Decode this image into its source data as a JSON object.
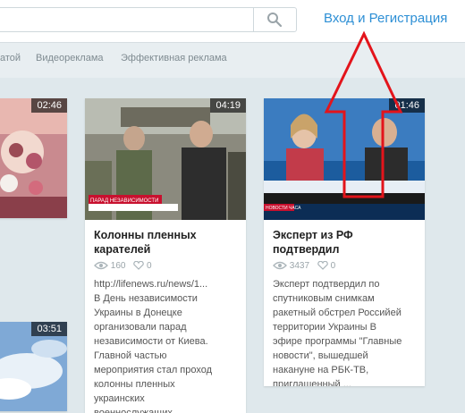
{
  "header": {
    "login_link": "Вход и Регистрация"
  },
  "nav": {
    "items": [
      "атой",
      "Видеореклама",
      "Эффективная реклама"
    ]
  },
  "cards": [
    {
      "duration": "02:46"
    },
    {
      "duration": "04:19",
      "title": "Колонны пленных\nкарателей",
      "views": "160",
      "likes": "0",
      "description": "http://lifenews.ru/news/1...\nВ День независимости\nУкраины в Донецке\nорганизовали парад\nнезависимости от Киева.\nГлавной частью\nмероприятия стал проход\nколонны пленных\nукраинских\nвоеннослужащих ...",
      "thumb_caption": "ПАРАД НЕЗАВИСИМОСТИ"
    },
    {
      "duration": "01:46",
      "title": "Эксперт из РФ\nподтвердил",
      "views": "3437",
      "likes": "0",
      "description": "Эксперт подтвердил по\nспутниковым снимкам\nракетный обстрел Российей\nтерритории Украины В\nэфире программы \"Главные\nновости\", вышедшей\nнакануне на РБК-ТВ,\nприглашенный ...",
      "thumb_caption": "НОВОСТИ ЧАСА"
    },
    {
      "duration": "03:51"
    }
  ],
  "colors": {
    "link": "#2d8fd5",
    "annotation": "#e3141b",
    "background": "#dfe8ec"
  }
}
